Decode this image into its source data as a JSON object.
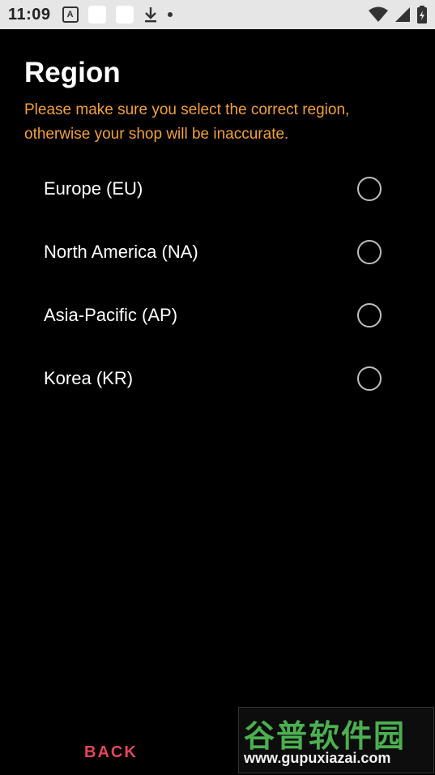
{
  "status_bar": {
    "time": "11:09",
    "notification_icons": [
      "a-badge-icon",
      "square-icon",
      "square-icon",
      "download-icon",
      "dot-icon"
    ],
    "system_icons": [
      "wifi-icon",
      "signal-icon",
      "battery-icon"
    ]
  },
  "header": {
    "title": "Region",
    "warning": "Please make sure you select the correct region, otherwise your shop will be inaccurate."
  },
  "regions": [
    {
      "label": "Europe (EU)",
      "selected": false
    },
    {
      "label": "North America (NA)",
      "selected": false
    },
    {
      "label": "Asia-Pacific (AP)",
      "selected": false
    },
    {
      "label": "Korea (KR)",
      "selected": false
    }
  ],
  "footer": {
    "back_label": "BACK"
  },
  "watermark": {
    "title": "谷普软件园",
    "url": "www.gupuxiazai.com"
  },
  "colors": {
    "background": "#000000",
    "warning": "#f0a040",
    "back_button": "#e0485a",
    "watermark_green": "#4caf50"
  }
}
